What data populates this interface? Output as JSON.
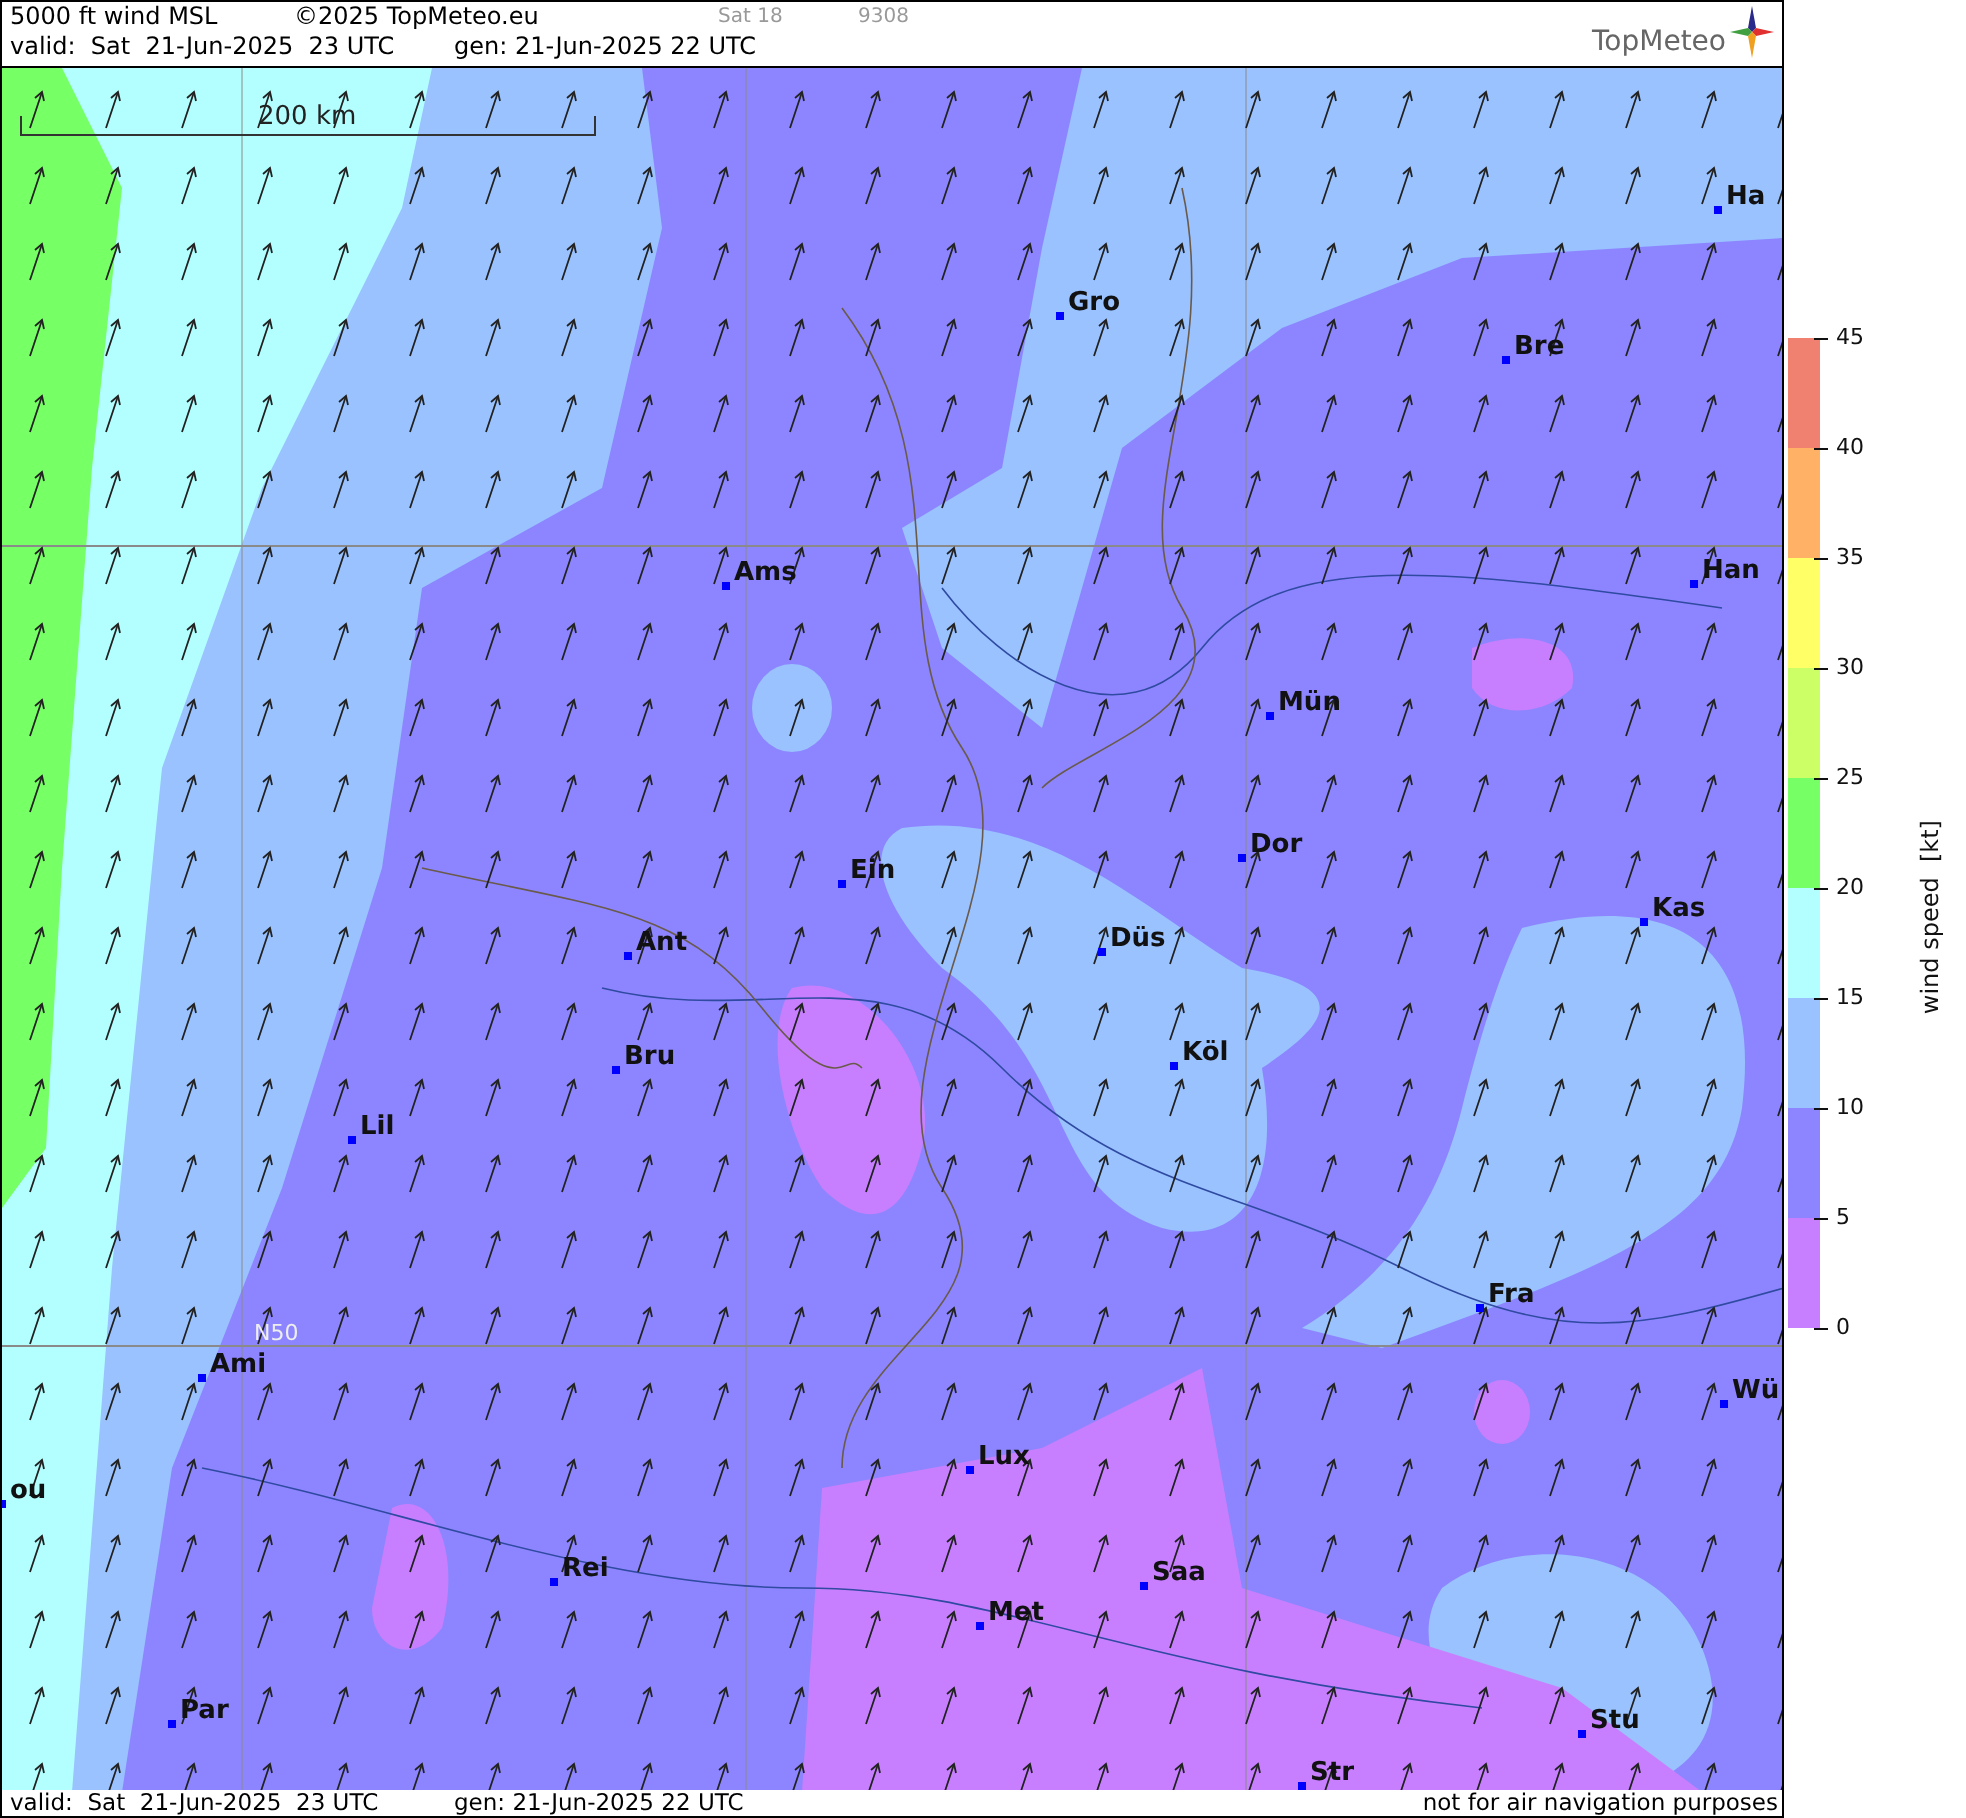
{
  "header": {
    "title": "5000 ft wind MSL",
    "copyright": "©2025 TopMeteo.eu",
    "frame": "Sat 18",
    "code": "9308",
    "valid": "valid:  Sat  21-Jun-2025  23 UTC",
    "generated": "gen: 21-Jun-2025 22 UTC",
    "logo": "TopMeteo"
  },
  "map": {
    "scale_label": "200 km",
    "latitude_label": "N50",
    "cities": [
      {
        "name": "Ha"
      },
      {
        "name": "Gro"
      },
      {
        "name": "Bre"
      },
      {
        "name": "Ams"
      },
      {
        "name": "Han"
      },
      {
        "name": "Mün"
      },
      {
        "name": "Dor"
      },
      {
        "name": "Ein"
      },
      {
        "name": "Kas"
      },
      {
        "name": "Ant"
      },
      {
        "name": "Düs"
      },
      {
        "name": "Köl"
      },
      {
        "name": "Bru"
      },
      {
        "name": "Lil"
      },
      {
        "name": "Fra"
      },
      {
        "name": "Ami"
      },
      {
        "name": "Wü"
      },
      {
        "name": "Lux"
      },
      {
        "name": "ou"
      },
      {
        "name": "Rei"
      },
      {
        "name": "Saa"
      },
      {
        "name": "Met"
      },
      {
        "name": "Par"
      },
      {
        "name": "Stu"
      },
      {
        "name": "Str"
      }
    ]
  },
  "legend": {
    "title": "wind speed  [kt]",
    "ticks": [
      "45",
      "40",
      "35",
      "30",
      "25",
      "20",
      "15",
      "10",
      "5",
      "0"
    ],
    "bands": [
      {
        "color": "#f08070"
      },
      {
        "color": "#ffb266"
      },
      {
        "color": "#ffff66"
      },
      {
        "color": "#ccff66"
      },
      {
        "color": "#77ff66"
      },
      {
        "color": "#b3ffff"
      },
      {
        "color": "#99c2ff"
      },
      {
        "color": "#8c85ff"
      },
      {
        "color": "#c77fff"
      }
    ]
  },
  "footer": {
    "valid": "valid:  Sat  21-Jun-2025  23 UTC",
    "generated": "gen: 21-Jun-2025 22 UTC",
    "disclaimer": "not for air navigation purposes"
  }
}
